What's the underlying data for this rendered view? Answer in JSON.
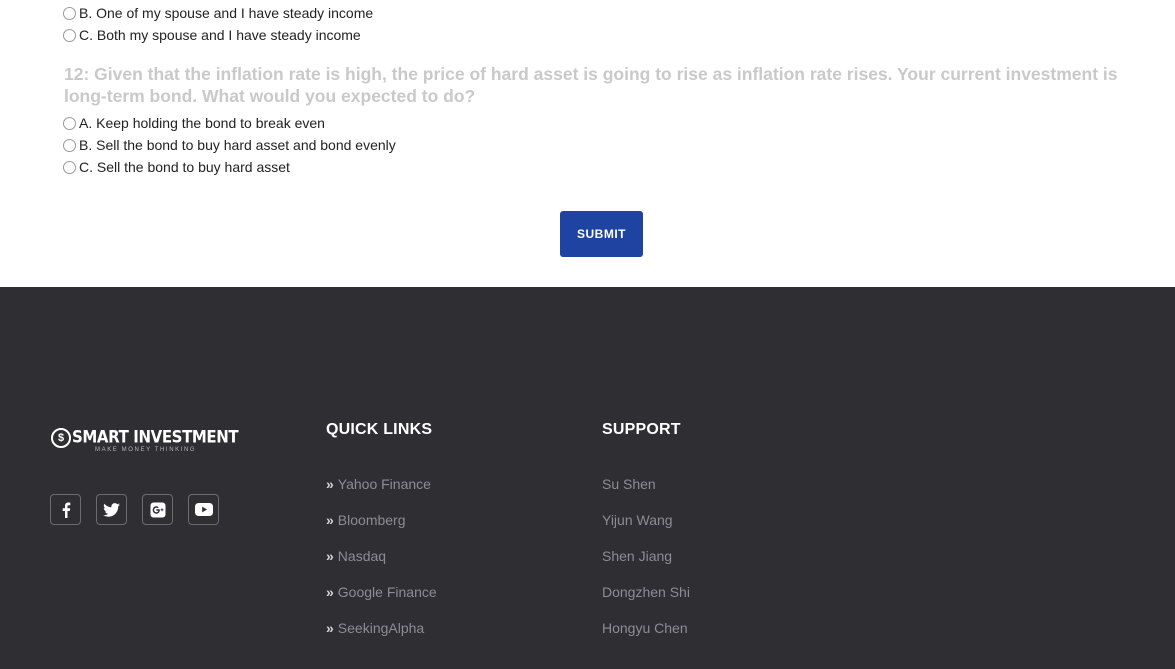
{
  "quiz": {
    "prev_options": [
      "B. One of my spouse and I have steady income",
      "C. Both my spouse and I have steady income"
    ],
    "question": "12: Given that the inflation rate is high, the price of hard asset is going to rise as inflation rate rises. Your current investment is long-term bond. What would you expected to do?",
    "options": [
      "A. Keep holding the bond to break even",
      "B. Sell the bond to buy hard asset and bond evenly",
      "C. Sell the bond to buy hard asset"
    ],
    "submit_label": "SUBMIT"
  },
  "footer": {
    "brand": {
      "name": "SMART INVESTMENT",
      "tagline": "MAKE MONEY THINKING",
      "logo_glyph": "$"
    },
    "social": [
      "facebook-icon",
      "twitter-icon",
      "google-plus-icon",
      "youtube-icon"
    ],
    "quick_links": {
      "title": "QUICK LINKS",
      "chevron": "»",
      "items": [
        "Yahoo Finance",
        "Bloomberg",
        "Nasdaq",
        "Google Finance",
        "SeekingAlpha"
      ]
    },
    "support": {
      "title": "SUPPORT",
      "items": [
        "Su Shen",
        "Yijun Wang",
        "Shen Jiang",
        "Dongzhen Shi",
        "Hongyu Chen"
      ]
    }
  },
  "colors": {
    "footer_bg": "#2e2e33",
    "submit_bg": "#1e43a0",
    "question_text": "#c9c9c9",
    "footer_link": "#8c8c92"
  }
}
